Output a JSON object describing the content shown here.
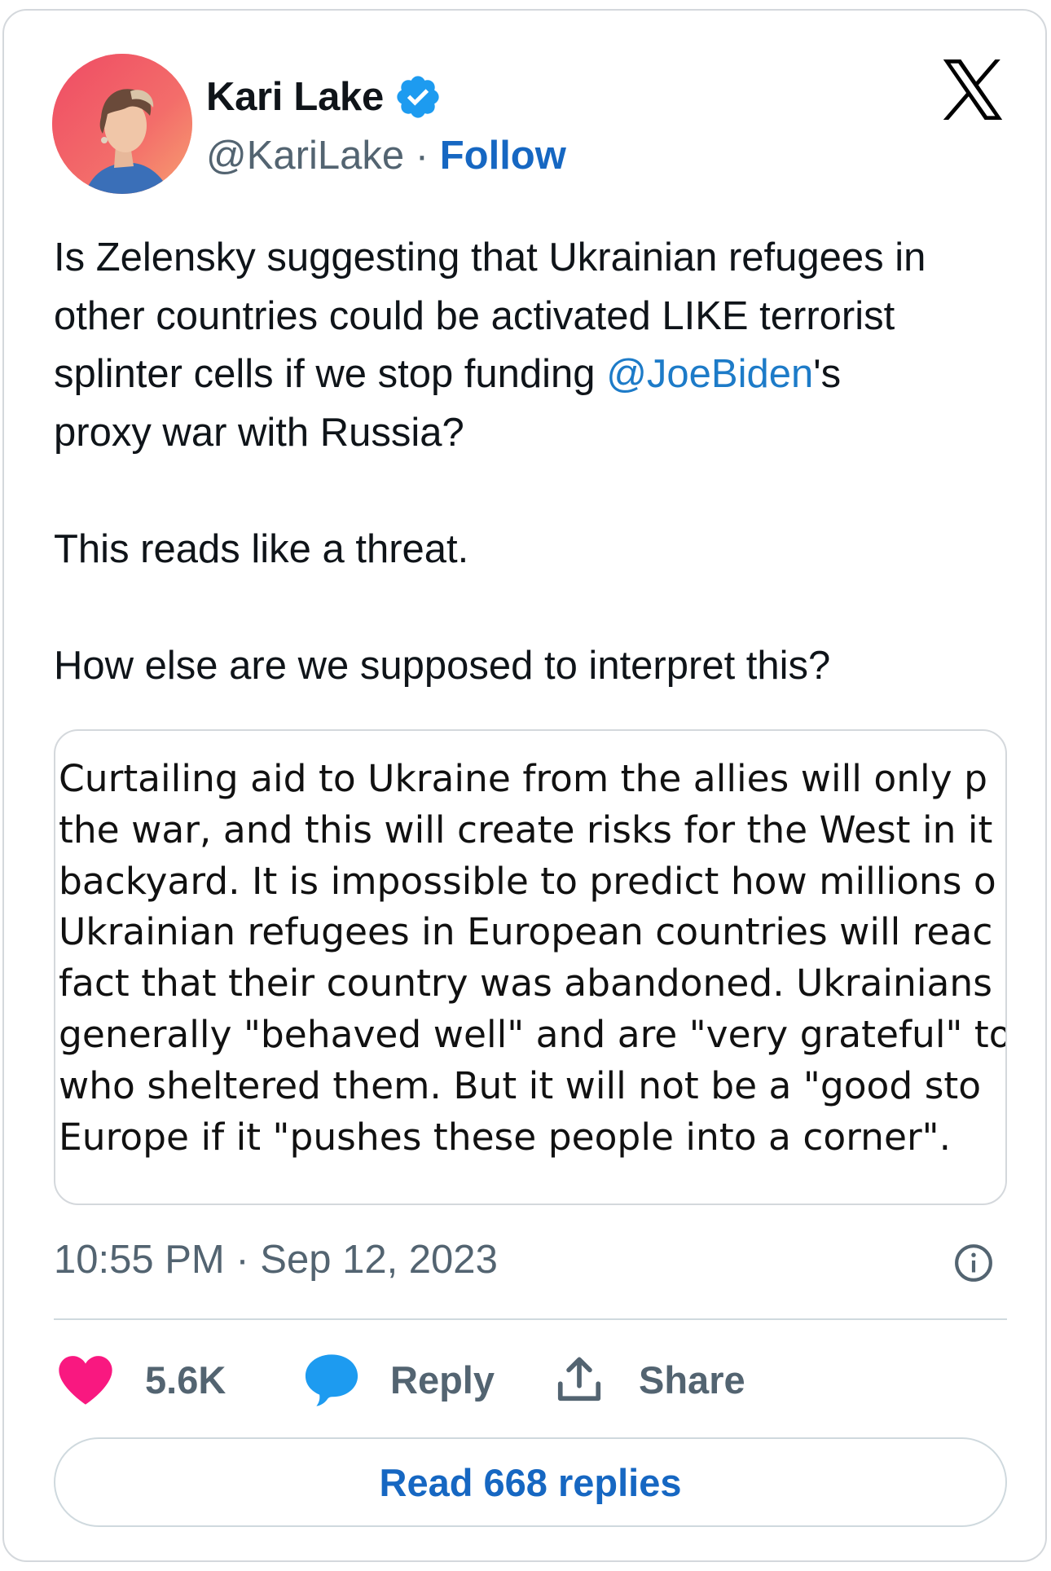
{
  "author": {
    "name": "Kari Lake",
    "handle": "@KariLake",
    "separator": "·",
    "follow_label": "Follow",
    "verified": true,
    "verified_color": "#1d9bf0"
  },
  "platform": {
    "logo": "x-logo-icon"
  },
  "tweet": {
    "paragraph1_before": "Is Zelensky suggesting that Ukrainian refugees in\nother countries could be activated LIKE terrorist\nsplinter cells if we stop funding ",
    "mention": "@JoeBiden",
    "paragraph1_after": "'s\nproxy war with Russia?",
    "paragraph2": "This reads like a threat.",
    "paragraph3": "How else are we supposed to interpret this?"
  },
  "media": {
    "lines": [
      "Curtailing aid to Ukraine from the allies will only p",
      "the war, and this will create risks for the West in it",
      "backyard. It is impossible to predict how millions o",
      "Ukrainian refugees in European countries will reac",
      "fact that their country was abandoned. Ukrainians",
      "generally \"behaved well\" and are \"very grateful\" to",
      "who sheltered them. But it will not be a \"good sto",
      "Europe if it \"pushes these people into a corner\"."
    ]
  },
  "timestamp": "10:55 PM · Sep 12, 2023",
  "actions": {
    "like_count": "5.6K",
    "reply_label": "Reply",
    "share_label": "Share"
  },
  "read_replies_label": "Read 668 replies",
  "colors": {
    "link": "#1667c2",
    "like": "#f91880",
    "reply": "#1d9bf0",
    "muted": "#536471"
  }
}
